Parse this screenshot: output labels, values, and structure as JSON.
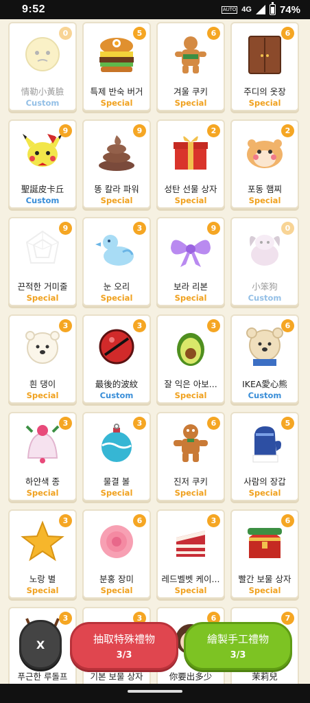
{
  "status": {
    "time": "9:52",
    "auto_label": "AUTO",
    "network": "4G",
    "battery": "74%"
  },
  "items": [
    {
      "name": "情勒小黃臉",
      "kind": "Custom",
      "count": "0",
      "icon": "yellow-face-icon",
      "faded": true
    },
    {
      "name": "특제 반숙 버거",
      "kind": "Special",
      "count": "5",
      "icon": "burger-icon",
      "faded": false
    },
    {
      "name": "겨울 쿠키",
      "kind": "Special",
      "count": "6",
      "icon": "gingerbread-cookie-icon",
      "faded": false
    },
    {
      "name": "주디의 옷장",
      "kind": "Special",
      "count": "6",
      "icon": "wardrobe-icon",
      "faded": false
    },
    {
      "name": "聖誕皮卡丘",
      "kind": "Custom",
      "count": "9",
      "icon": "pikachu-icon",
      "faded": false
    },
    {
      "name": "똥 칼라 파워",
      "kind": "Special",
      "count": "9",
      "icon": "poop-icon",
      "faded": false
    },
    {
      "name": "성탄 선물 상자",
      "kind": "Special",
      "count": "2",
      "icon": "gift-box-icon",
      "faded": false
    },
    {
      "name": "포동 햄찌",
      "kind": "Special",
      "count": "2",
      "icon": "hamster-icon",
      "faded": false
    },
    {
      "name": "끈적한 거미줄",
      "kind": "Special",
      "count": "9",
      "icon": "spider-web-icon",
      "faded": false
    },
    {
      "name": "눈 오리",
      "kind": "Special",
      "count": "3",
      "icon": "snow-duck-icon",
      "faded": false
    },
    {
      "name": "보라 리본",
      "kind": "Special",
      "count": "9",
      "icon": "purple-ribbon-icon",
      "faded": false
    },
    {
      "name": "小笨狗",
      "kind": "Custom",
      "count": "0",
      "icon": "dog-icon",
      "faded": true
    },
    {
      "name": "흰 댕이",
      "kind": "Special",
      "count": "3",
      "icon": "white-dog-icon",
      "faded": false
    },
    {
      "name": "最後的波紋",
      "kind": "Custom",
      "count": "3",
      "icon": "red-sphere-icon",
      "faded": false
    },
    {
      "name": "잘 익은 아보...",
      "kind": "Special",
      "count": "3",
      "icon": "avocado-icon",
      "faded": false
    },
    {
      "name": "IKEA愛心熊",
      "kind": "Custom",
      "count": "6",
      "icon": "bear-icon",
      "faded": false
    },
    {
      "name": "하얀색 종",
      "kind": "Special",
      "count": "3",
      "icon": "bell-icon",
      "faded": false
    },
    {
      "name": "물결 볼",
      "kind": "Special",
      "count": "3",
      "icon": "ornament-ball-icon",
      "faded": false
    },
    {
      "name": "진저 쿠키",
      "kind": "Special",
      "count": "6",
      "icon": "ginger-cookie-icon",
      "faded": false
    },
    {
      "name": "사람의 장갑",
      "kind": "Special",
      "count": "5",
      "icon": "mitten-icon",
      "faded": false
    },
    {
      "name": "노랑 별",
      "kind": "Special",
      "count": "3",
      "icon": "star-icon",
      "faded": false
    },
    {
      "name": "분홍 장미",
      "kind": "Special",
      "count": "6",
      "icon": "rose-icon",
      "faded": false
    },
    {
      "name": "레드벨벳 케이...",
      "kind": "Special",
      "count": "3",
      "icon": "cake-icon",
      "faded": false
    },
    {
      "name": "빨간 보물 상자",
      "kind": "Special",
      "count": "6",
      "icon": "treasure-chest-icon",
      "faded": false
    },
    {
      "name": "푸근한 루돌프",
      "kind": "",
      "count": "3",
      "icon": "reindeer-icon",
      "faded": false
    },
    {
      "name": "기본 보물 상자",
      "kind": "",
      "count": "3",
      "icon": "chest-icon",
      "faded": false
    },
    {
      "name": "你要出多少",
      "kind": "",
      "count": "6",
      "icon": "character-icon",
      "faded": false
    },
    {
      "name": "茉莉兒",
      "kind": "",
      "count": "7",
      "icon": "jasmine-icon",
      "faded": false
    }
  ],
  "actions": {
    "close_label": "X",
    "draw_special_title": "抽取特殊禮物",
    "draw_special_count": "3/3",
    "draw_craft_title": "繪製手工禮物",
    "draw_craft_count": "3/3"
  }
}
